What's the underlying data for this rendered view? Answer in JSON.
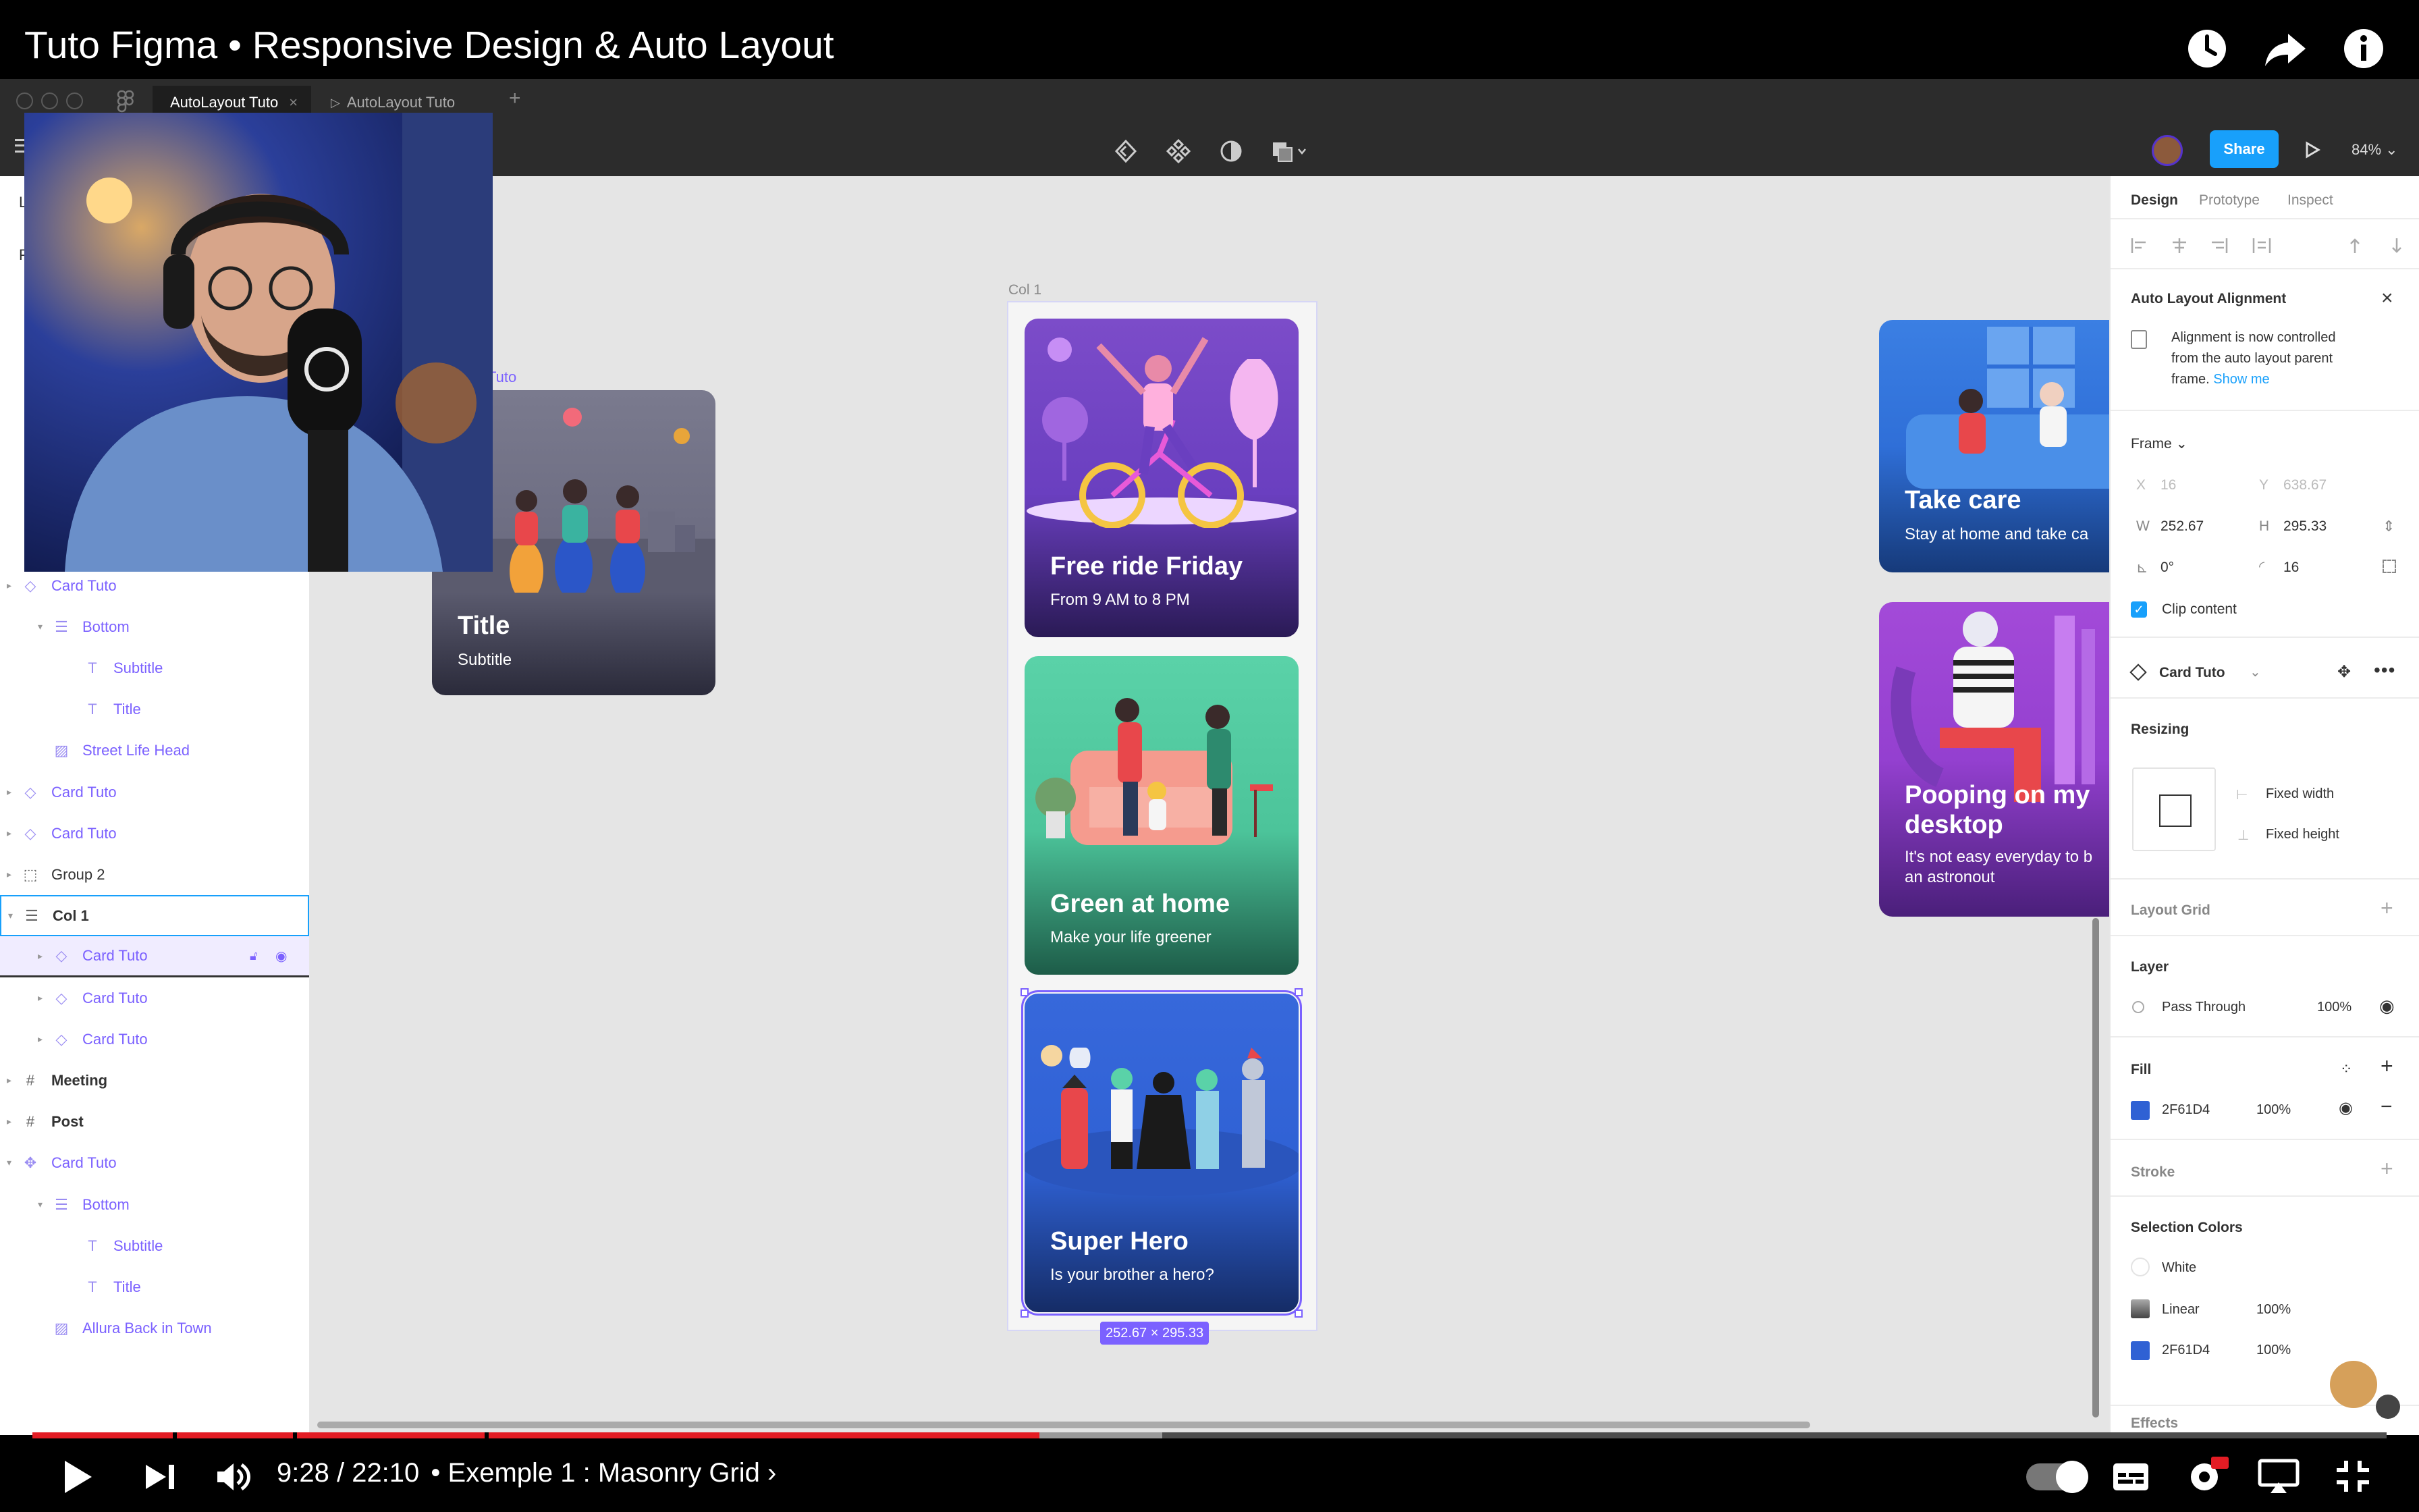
{
  "video": {
    "title": "Tuto Figma • Responsive Design & Auto Layout",
    "time": "9:28 / 22:10",
    "chapter": "• Exemple 1 : Masonry Grid ›",
    "progress_fraction": 0.4277,
    "buffered_fraction": 0.48
  },
  "figma": {
    "tabs": [
      "AutoLayout Tuto",
      "AutoLayout Tuto"
    ],
    "tab_close": "×",
    "tab_add": "+",
    "share_label": "Share",
    "zoom": "84%",
    "canvas_frame_label": "Col 1",
    "selection_size": "252.67 × 295.33",
    "partial_frame_label": "Tuto",
    "layers_left_fragments": [
      "L",
      "P"
    ]
  },
  "layers": [
    {
      "name": "Card Tuto",
      "kind": "instance",
      "indent": 0,
      "caret": "right",
      "style": "component"
    },
    {
      "name": "Bottom",
      "kind": "autolayout",
      "indent": 1,
      "caret": "down",
      "style": "component"
    },
    {
      "name": "Subtitle",
      "kind": "text",
      "indent": 2,
      "caret": "",
      "style": "component"
    },
    {
      "name": "Title",
      "kind": "text",
      "indent": 2,
      "caret": "",
      "style": "component"
    },
    {
      "name": "Street Life Head",
      "kind": "image",
      "indent": 1,
      "caret": "",
      "style": "component"
    },
    {
      "name": "Card Tuto",
      "kind": "instance",
      "indent": 0,
      "caret": "right",
      "style": "component"
    },
    {
      "name": "Card Tuto",
      "kind": "instance",
      "indent": 0,
      "caret": "right",
      "style": "component"
    },
    {
      "name": "Group 2",
      "kind": "group",
      "indent": 0,
      "caret": "right",
      "style": "dark"
    },
    {
      "name": "Col 1",
      "kind": "autolayout",
      "indent": 0,
      "caret": "down",
      "style": "dark-bold-selected"
    },
    {
      "name": "Card Tuto",
      "kind": "instance",
      "indent": 1,
      "caret": "right",
      "style": "component-hover"
    },
    {
      "name": "Card Tuto",
      "kind": "instance",
      "indent": 1,
      "caret": "right",
      "style": "component"
    },
    {
      "name": "Card Tuto",
      "kind": "instance",
      "indent": 1,
      "caret": "right",
      "style": "component"
    },
    {
      "name": "Meeting",
      "kind": "frame",
      "indent": 0,
      "caret": "right",
      "style": "dark-bold"
    },
    {
      "name": "Post",
      "kind": "frame",
      "indent": 0,
      "caret": "right",
      "style": "dark-bold"
    },
    {
      "name": "Card Tuto",
      "kind": "component",
      "indent": 0,
      "caret": "down",
      "style": "component"
    },
    {
      "name": "Bottom",
      "kind": "autolayout",
      "indent": 1,
      "caret": "down",
      "style": "component"
    },
    {
      "name": "Subtitle",
      "kind": "text",
      "indent": 2,
      "caret": "",
      "style": "component"
    },
    {
      "name": "Title",
      "kind": "text",
      "indent": 2,
      "caret": "",
      "style": "component"
    },
    {
      "name": "Allura Back in Town",
      "kind": "image",
      "indent": 1,
      "caret": "",
      "style": "component"
    }
  ],
  "cards": {
    "master": {
      "title": "Title",
      "subtitle": "Subtitle"
    },
    "col1": [
      {
        "title": "Free ride Friday",
        "subtitle": "From 9 AM to 8 PM"
      },
      {
        "title": "Green at home",
        "subtitle": "Make your life greener"
      },
      {
        "title": "Super Hero",
        "subtitle": "Is your brother a hero?"
      }
    ],
    "col2": [
      {
        "title": "Take care",
        "subtitle": "Stay at home and take ca"
      },
      {
        "title": "Pooping on my desktop",
        "subtitle_line1": "It's not easy everyday to b",
        "subtitle_line2": "an astronout"
      }
    ]
  },
  "props": {
    "tabs": [
      "Design",
      "Prototype",
      "Inspect"
    ],
    "alignment_title": "Auto Layout Alignment",
    "alignment_line1": "Alignment is now controlled",
    "alignment_line2": "from the auto layout parent",
    "alignment_line3": "frame.",
    "show_me": "Show me",
    "frame_label": "Frame ⌄",
    "x_label": "X",
    "x_value": "16",
    "y_label": "Y",
    "y_value": "638.67",
    "w_label": "W",
    "w_value": "252.67",
    "h_label": "H",
    "h_value": "295.33",
    "rotation": "0°",
    "radius": "16",
    "clip_content": "Clip content",
    "component_name": "Card Tuto",
    "resizing": "Resizing",
    "fixed_width": "Fixed width",
    "fixed_height": "Fixed height",
    "layout_grid": "Layout Grid",
    "layer": "Layer",
    "blend": "Pass Through",
    "opacity": "100%",
    "fill": "Fill",
    "fill_hex": "2F61D4",
    "fill_opacity": "100%",
    "stroke": "Stroke",
    "selection_colors": "Selection Colors",
    "sel_colors": [
      {
        "name": "White",
        "opacity": "",
        "color": "#ffffff"
      },
      {
        "name": "Linear",
        "opacity": "100%",
        "color": "#5b5b5b"
      },
      {
        "name": "2F61D4",
        "opacity": "100%",
        "color": "#2F61D4"
      }
    ],
    "effects": "Effects"
  },
  "colors": {
    "figma_dark": "#2c2c2c",
    "share_blue": "#18a0fb",
    "component_purple": "#7b61ff",
    "fill_blue": "#2F61D4",
    "youtube_red": "#e31c24"
  }
}
